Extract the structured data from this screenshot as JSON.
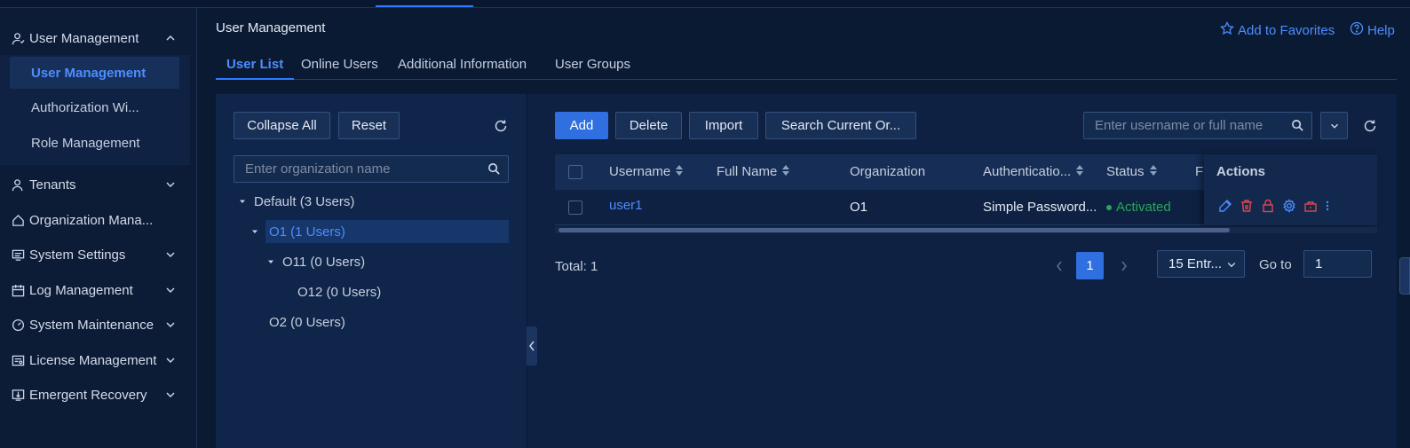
{
  "sidebar": {
    "items": [
      {
        "label": "User Management",
        "expanded": true
      },
      {
        "label": "Tenants"
      },
      {
        "label": "Organization Mana..."
      },
      {
        "label": "System Settings"
      },
      {
        "label": "Log Management"
      },
      {
        "label": "System Maintenance"
      },
      {
        "label": "License Management"
      },
      {
        "label": "Emergent Recovery"
      }
    ],
    "subitems": [
      {
        "label": "User Management",
        "active": true
      },
      {
        "label": "Authorization Wi..."
      },
      {
        "label": "Role Management"
      }
    ]
  },
  "header": {
    "title": "User Management",
    "favorites": "Add to Favorites",
    "help": "Help"
  },
  "tabs": [
    {
      "label": "User List",
      "active": true
    },
    {
      "label": "Online Users"
    },
    {
      "label": "Additional Information"
    },
    {
      "label": "User Groups"
    }
  ],
  "left_panel": {
    "collapse_all": "Collapse All",
    "reset": "Reset",
    "search_placeholder": "Enter organization name",
    "tree": [
      {
        "label": "Default (3 Users)"
      },
      {
        "label": "O1 (1 Users)",
        "selected": true
      },
      {
        "label": "O11 (0 Users)"
      },
      {
        "label": "O12 (0 Users)"
      },
      {
        "label": "O2 (0 Users)"
      }
    ]
  },
  "toolbar": {
    "add": "Add",
    "delete": "Delete",
    "import": "Import",
    "search_current": "Search Current Or...",
    "search_placeholder": "Enter username or full name"
  },
  "table": {
    "columns": [
      "Username",
      "Full Name",
      "Organization",
      "Authenticatio...",
      "Status",
      "F",
      "Actions"
    ],
    "rows": [
      {
        "username": "user1",
        "full_name": "",
        "organization": "O1",
        "auth": "Simple Password...",
        "status": "Activated"
      }
    ]
  },
  "pagination": {
    "total": "Total: 1",
    "current_page": "1",
    "page_size": "15 Entr...",
    "goto_label": "Go to",
    "goto_value": "1"
  },
  "colors": {
    "accent": "#2f7bff",
    "link": "#4d8dff",
    "status_active": "#27a85a",
    "danger": "#e0464e"
  }
}
